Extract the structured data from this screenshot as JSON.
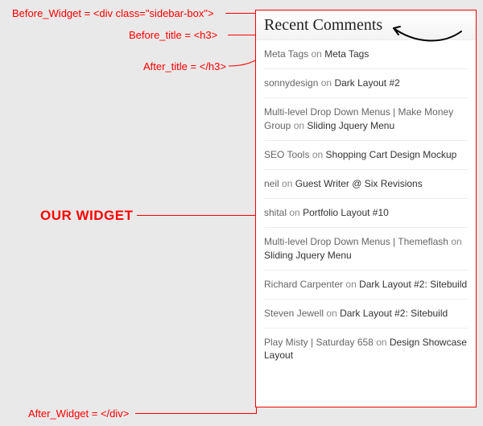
{
  "annotations": {
    "before_widget": "Before_Widget = <div class=\"sidebar-box\">",
    "before_title": "Before_title = <h3>",
    "after_title": "After_title = </h3>",
    "our_widget": "OUR WIDGET",
    "after_widget": "After_Widget = </div>"
  },
  "widget": {
    "title": "Recent Comments",
    "comments": [
      {
        "author": "Meta Tags",
        "on": "on",
        "post": "Meta Tags"
      },
      {
        "author": "sonnydesign",
        "on": "on",
        "post": "Dark Layout #2"
      },
      {
        "author": "Multi-level Drop Down Menus | Make Money Group",
        "on": "on",
        "post": "Sliding Jquery Menu"
      },
      {
        "author": "SEO Tools",
        "on": "on",
        "post": "Shopping Cart Design Mockup"
      },
      {
        "author": "neil",
        "on": "on",
        "post": "Guest Writer @ Six Revisions"
      },
      {
        "author": "shital",
        "on": "on",
        "post": "Portfolio Layout #10"
      },
      {
        "author": "Multi-level Drop Down Menus | Themeflash",
        "on": "on",
        "post": "Sliding Jquery Menu"
      },
      {
        "author": "Richard Carpenter",
        "on": "on",
        "post": "Dark Layout #2: Sitebuild"
      },
      {
        "author": "Steven Jewell",
        "on": "on",
        "post": "Dark Layout #2: Sitebuild"
      },
      {
        "author": "Play Misty | Saturday 658",
        "on": "on",
        "post": "Design Showcase Layout"
      }
    ]
  }
}
